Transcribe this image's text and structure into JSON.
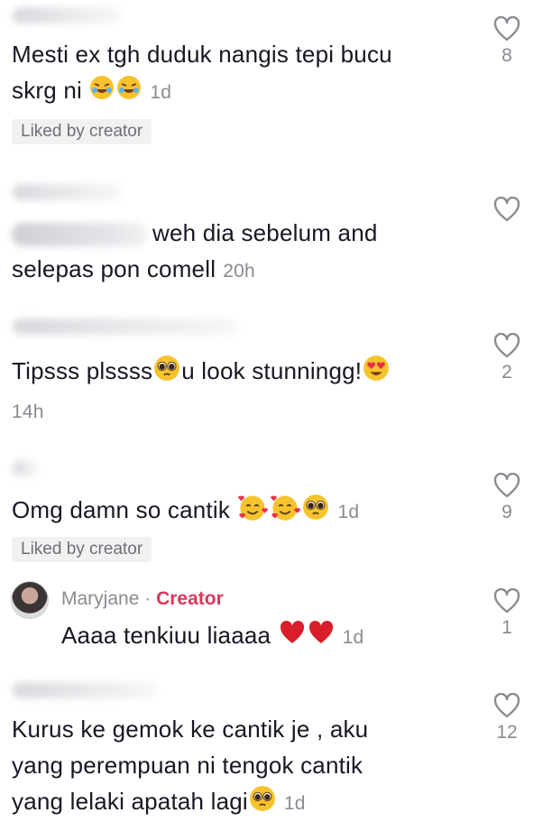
{
  "comments": [
    {
      "text": "Mesti ex tgh duduk nangis tepi bucu skrg ni",
      "text_line1": "Mesti ex tgh duduk nangis tepi bucu",
      "text_line2_prefix": "skrg ni",
      "emoji": [
        "rofl-emoji",
        "rofl-emoji"
      ],
      "time": "1d",
      "liked_by_creator": "Liked by creator",
      "likes": "8"
    },
    {
      "text_line1": "weh dia sebelum and",
      "text_line2": "selepas pon comell",
      "time": "20h",
      "likes": ""
    },
    {
      "text_prefix": "Tipsss plssss",
      "text_mid": "u look stunningg!",
      "emoji": [
        "pleading-face-emoji",
        "heart-eyes-emoji"
      ],
      "time": "14h",
      "likes": "2"
    },
    {
      "text": "Omg damn so cantik",
      "emoji": [
        "smiling-hearts-emoji",
        "smiling-hearts-emoji",
        "pleading-face-emoji"
      ],
      "time": "1d",
      "liked_by_creator": "Liked by creator",
      "likes": "9"
    }
  ],
  "reply": {
    "username": "Maryjane",
    "separator": "·",
    "badge": "Creator",
    "text": "Aaaa tenkiuu liaaaa",
    "emoji": [
      "red-heart-emoji",
      "red-heart-emoji"
    ],
    "time": "1d",
    "likes": "1"
  },
  "last_comment": {
    "line1": "Kurus ke gemok ke cantik je , aku",
    "line2": "yang perempuan ni tengok cantik",
    "line3": "yang lelaki apatah lagi",
    "emoji": [
      "pleading-face-emoji"
    ],
    "time": "1d",
    "likes": "12"
  },
  "colors": {
    "creator": "#d8395c",
    "muted": "#8a8b91",
    "text": "#161823"
  }
}
